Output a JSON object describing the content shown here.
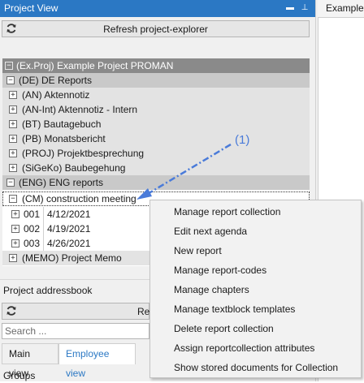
{
  "project_view": {
    "title": "Project View",
    "refresh_label": "Refresh project-explorer",
    "tree": [
      {
        "label": "(Ex.Proj) Example Project PROMAN",
        "toggle": "−"
      },
      {
        "label": "(DE) DE Reports",
        "toggle": "−"
      },
      {
        "label": "(AN) Aktennotiz",
        "toggle": "+"
      },
      {
        "label": "(AN-Int) Aktennotiz - Intern",
        "toggle": "+"
      },
      {
        "label": "(BT) Bautagebuch",
        "toggle": "+"
      },
      {
        "label": "(PB) Monatsbericht",
        "toggle": "+"
      },
      {
        "label": "(PROJ) Projektbesprechung",
        "toggle": "+"
      },
      {
        "label": "(SiGeKo) Baubegehung",
        "toggle": "+"
      },
      {
        "label": "(ENG) ENG reports",
        "toggle": "−"
      },
      {
        "label": "(CM) construction meeting",
        "toggle": "−"
      },
      {
        "label": "001",
        "date": "4/12/2021",
        "toggle": "+"
      },
      {
        "label": "002",
        "date": "4/19/2021",
        "toggle": "+"
      },
      {
        "label": "003",
        "date": "4/26/2021",
        "toggle": "+"
      },
      {
        "label": "(MEMO) Project Memo",
        "toggle": "+"
      }
    ]
  },
  "addressbook": {
    "title": "Project addressbook",
    "refresh_label": "Re",
    "search_placeholder": "Search ...",
    "tabs": [
      "Main view",
      "Employee view"
    ],
    "groups_label": "Groups"
  },
  "right_pane": {
    "tab_label": "Example Project"
  },
  "context_menu": {
    "items": [
      "Manage report collection",
      "Edit next agenda",
      "New report",
      "Manage report-codes",
      "Manage chapters",
      "Manage textblock templates",
      "Delete report collection",
      "Assign reportcollection attributes",
      "Show stored documents for Collection"
    ]
  },
  "annotation": {
    "label": "(1)",
    "color": "#4a7bd9"
  },
  "colors": {
    "accent": "#2b78c4"
  }
}
